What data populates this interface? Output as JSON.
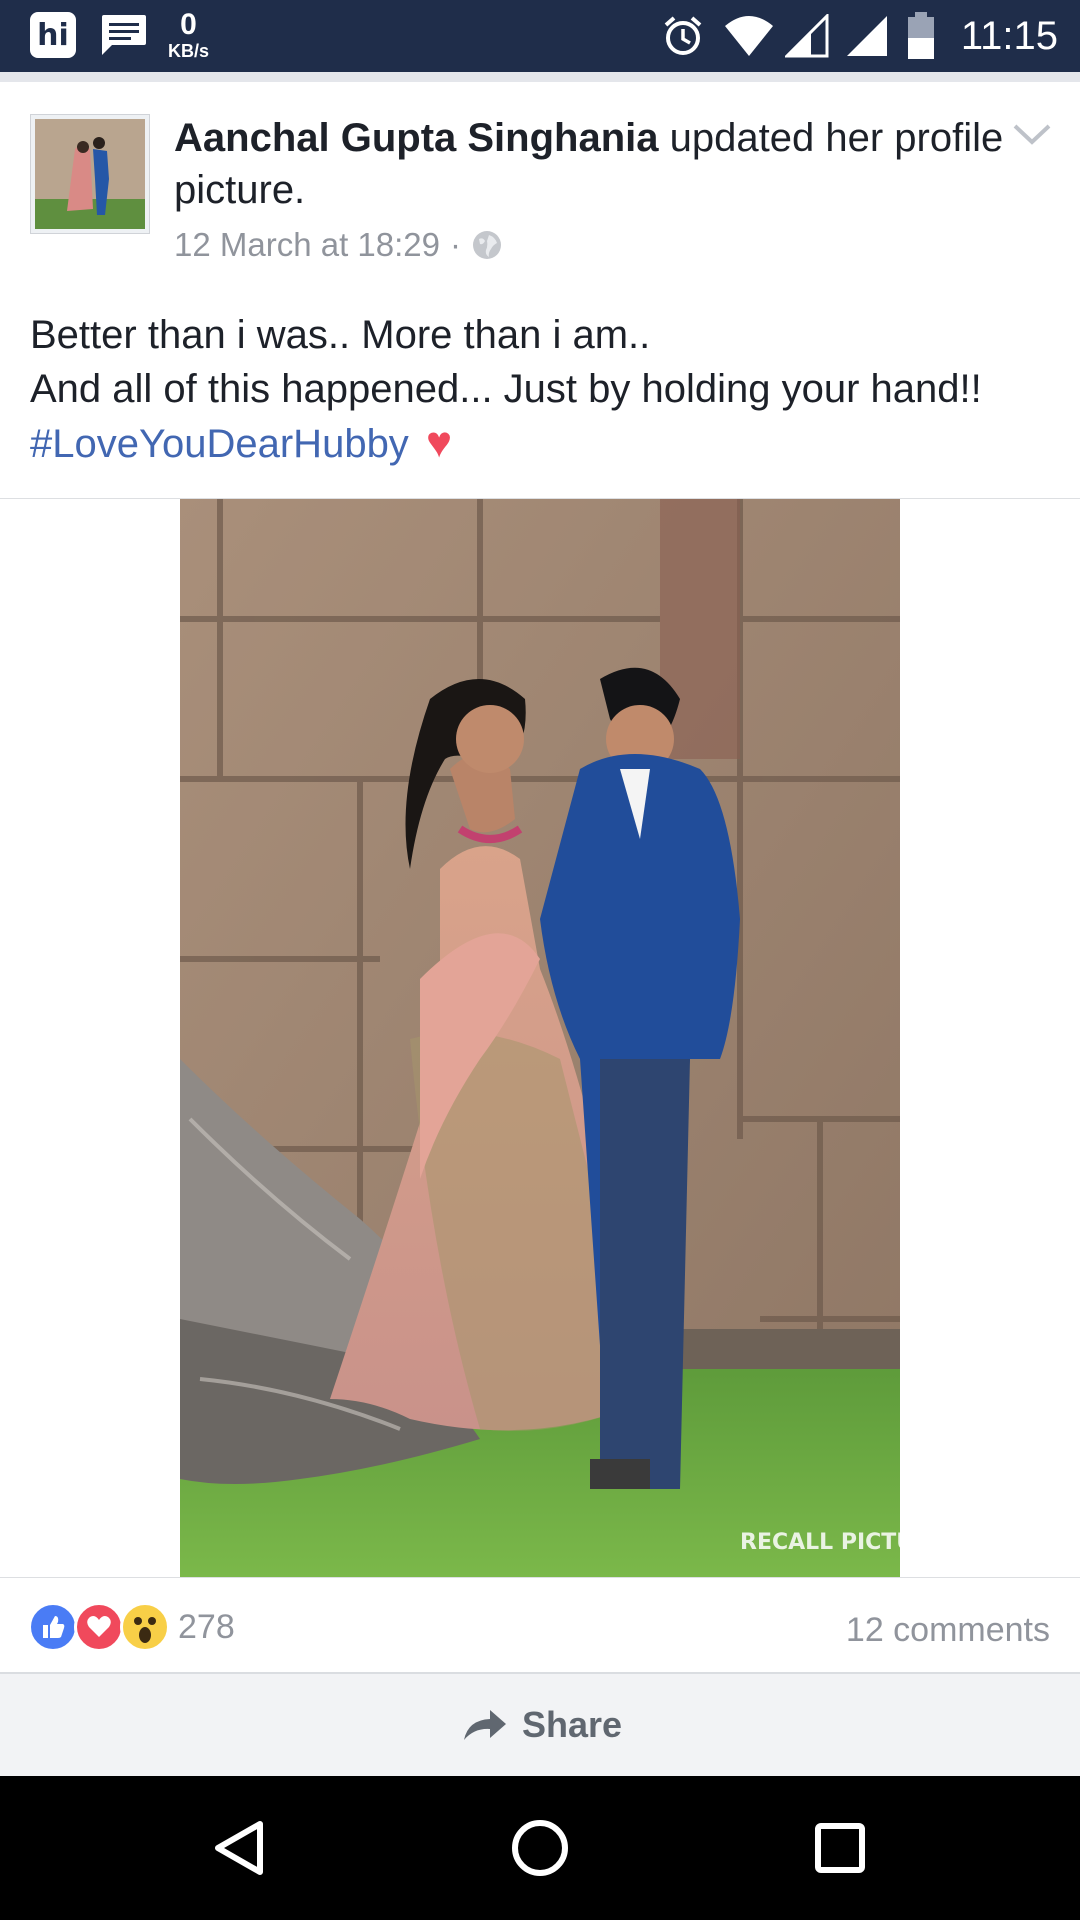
{
  "status_bar": {
    "app_icon": "hi-app-icon",
    "message_icon": "message-icon",
    "speed_value": "0",
    "speed_unit": "KB/s",
    "icons": [
      "alarm-icon",
      "wifi-icon",
      "signal-icon",
      "signal-icon",
      "battery-icon"
    ],
    "time": "11:15"
  },
  "post": {
    "author": "Aanchal Gupta Singhania",
    "action": "updated her profile picture.",
    "timestamp": "12 March at 18:29",
    "separator": "·",
    "privacy_icon": "globe-icon",
    "menu_icon": "chevron-down-icon",
    "text_lines": [
      "Better than i was.. More than i am..",
      "And all of this happened... Just by holding your hand!!"
    ],
    "hashtag": "#LoveYouDearHubby",
    "emoji": "♥",
    "photo_watermark": "RECALL PICTURES"
  },
  "engagement": {
    "reactions": [
      "like-icon",
      "love-icon",
      "wow-icon"
    ],
    "reaction_count": "278",
    "comments": "12 comments"
  },
  "actions": {
    "share_label": "Share"
  },
  "nav": {
    "buttons": [
      "back-button",
      "home-button",
      "recents-button"
    ]
  },
  "colors": {
    "status_bar": "#1f2d4a",
    "link": "#4267b2",
    "like": "#4a7cf5",
    "love": "#f0495c",
    "wow": "#f8cf47"
  }
}
